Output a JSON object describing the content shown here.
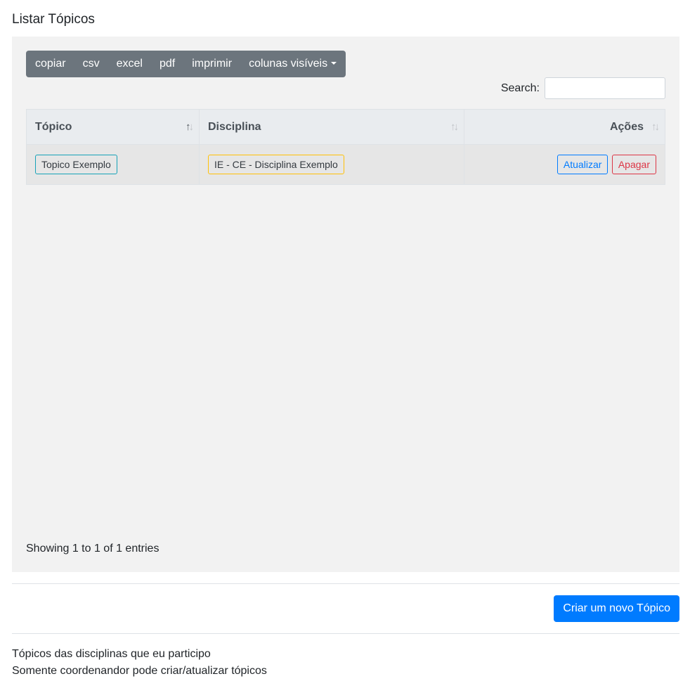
{
  "page": {
    "title": "Listar Tópicos"
  },
  "toolbar": {
    "buttons": [
      "copiar",
      "csv",
      "excel",
      "pdf",
      "imprimir"
    ],
    "column_visibility_label": "colunas visíveis"
  },
  "search": {
    "label": "Search:",
    "value": ""
  },
  "table": {
    "headers": [
      "Tópico",
      "Disciplina",
      "Ações"
    ],
    "rows": [
      {
        "topico": "Topico Exemplo",
        "disciplina": "IE - CE - Disciplina Exemplo",
        "actions": [
          "Atualizar",
          "Apagar"
        ]
      }
    ],
    "info": "Showing 1 to 1 of 1 entries"
  },
  "create_button": "Criar um novo Tópico",
  "footer": {
    "line1": "Tópicos das disciplinas que eu participo",
    "line2": "Somente coordenandor pode criar/atualizar tópicos"
  },
  "colors": {
    "primary": "#007bff",
    "danger": "#dc3545",
    "info": "#17a2b8",
    "warning": "#ffc107",
    "secondary": "#6c757d"
  }
}
